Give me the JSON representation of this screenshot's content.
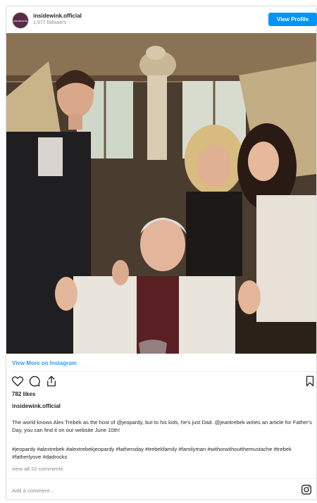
{
  "header": {
    "avatar_text": "insidewink",
    "username": "insidewink.official",
    "followers": "1,977 followers",
    "view_profile_label": "View Profile"
  },
  "view_more_label": "View More on Instagram",
  "likes": "782 likes",
  "caption": {
    "username": "insidewink.official",
    "text": "The world knows Alex Trebek as the host of @jeopardy, but to his kids, he's just Dad. @jeantrebek writes an article for Father's Day, you can find it on our website June 10th!",
    "tags": "#jeopardy #alextrebek #alextrebekjeopardy #fathersday #trebekfamily #familyman #withorwithoutthemustache #trebek #fatherlyove #dadrocks"
  },
  "view_all_comments": "view all 32 comments",
  "comment_placeholder": "Add a comment...",
  "colors": {
    "accent": "#0095f6",
    "link": "#3897f0",
    "muted": "#8e8e8e"
  },
  "icons": [
    "heart-icon",
    "comment-icon",
    "share-icon",
    "bookmark-icon",
    "instagram-icon"
  ]
}
